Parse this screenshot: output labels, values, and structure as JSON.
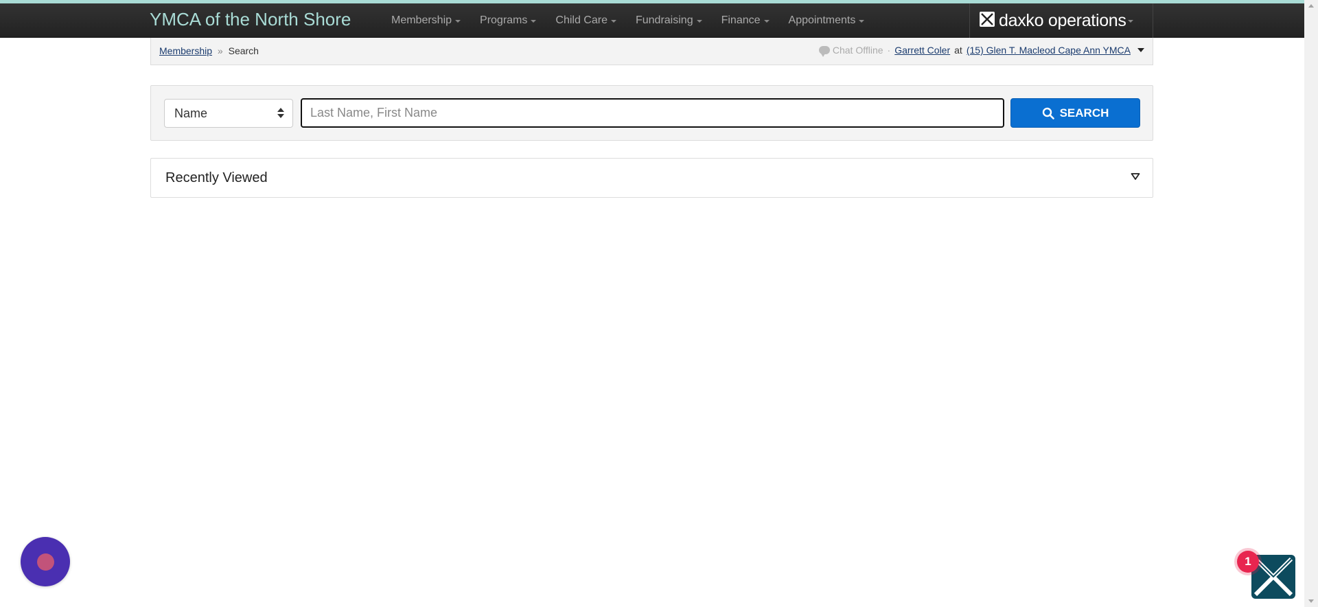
{
  "brand": {
    "title": "YMCA of the North Shore",
    "accent_color": "#a9dcd6"
  },
  "nav": {
    "items": [
      {
        "label": "Membership"
      },
      {
        "label": "Programs"
      },
      {
        "label": "Child Care"
      },
      {
        "label": "Fundraising"
      },
      {
        "label": "Finance"
      },
      {
        "label": "Appointments"
      }
    ],
    "product": {
      "label": "daxko operations",
      "icon": "daxko-logo-icon"
    }
  },
  "breadcrumb": {
    "parent": "Membership",
    "separator": "»",
    "current": "Search"
  },
  "userbar": {
    "chat_status": "Chat Offline",
    "separator": "·",
    "user": "Garrett Coler",
    "at": "at",
    "location": "(15) Glen T. Macleod Cape Ann YMCA"
  },
  "search": {
    "type_selected": "Name",
    "placeholder": "Last Name, First Name",
    "value": "",
    "button_label": "SEARCH",
    "button_color": "#0a6fd1"
  },
  "recently_viewed": {
    "title": "Recently Viewed"
  },
  "widgets": {
    "chat_launcher_color": "#4a2fb1",
    "notification_count": "1"
  }
}
